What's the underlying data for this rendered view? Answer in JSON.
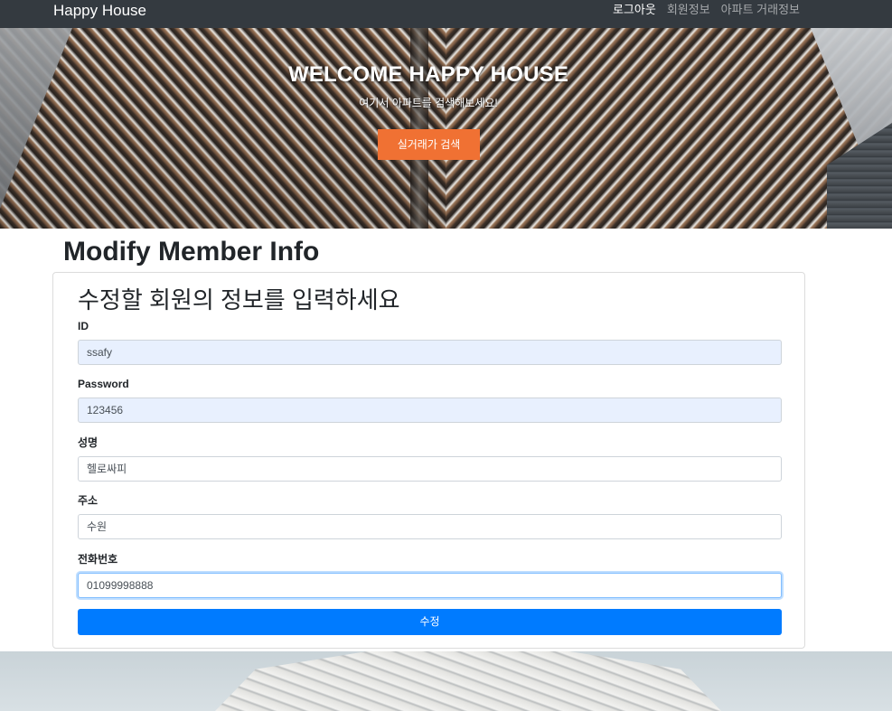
{
  "navbar": {
    "brand": "Happy House",
    "links": [
      "로그아웃",
      "회원정보",
      "아파트 거래정보"
    ]
  },
  "hero": {
    "title": "WELCOME HAPPY HOUSE",
    "subtitle": "여기서 아파트를 검색해보세요!",
    "button_label": "실거래가 검색"
  },
  "page": {
    "title": "Modify Member Info"
  },
  "form": {
    "heading": "수정할 회원의 정보를 입력하세요",
    "fields": [
      {
        "label": "ID",
        "value": "ssafy"
      },
      {
        "label": "Password",
        "value": "123456"
      },
      {
        "label": "성명",
        "value": "헬로싸피"
      },
      {
        "label": "주소",
        "value": "수원"
      },
      {
        "label": "전화번호",
        "value": "01099998888"
      }
    ],
    "submit_label": "수정"
  },
  "colors": {
    "navbar": "#343a40",
    "hero_button": "#f07133",
    "submit_button": "#007bff",
    "autofill_input": "#e8f0fe"
  }
}
